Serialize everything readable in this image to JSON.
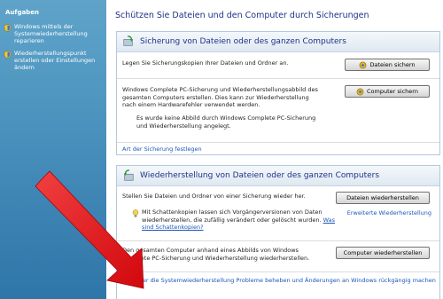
{
  "sidebar": {
    "title": "Aufgaben",
    "tasks": [
      {
        "label": "Windows mittels der Systemwiederherstellung reparieren"
      },
      {
        "label": "Wiederherstellungspunkt erstellen oder Einstellungen ändern"
      }
    ]
  },
  "main": {
    "title": "Schützen Sie Dateien und den Computer durch Sicherungen"
  },
  "backup_panel": {
    "heading": "Sicherung von Dateien oder des ganzen Computers",
    "file_text": "Legen Sie Sicherungskopien Ihrer Dateien und Ordner an.",
    "file_button": "Dateien sichern",
    "pc_text": "Windows Complete PC-Sicherung und Wiederherstellungsabbild des gesamten Computers erstellen. Dies kann zur Wiederherstellung nach einem Hardwarefehler verwendet werden.",
    "pc_button": "Computer sichern",
    "pc_note": "Es wurde keine Abbild durch Windows Complete PC-Sicherung und Wiederherstellung angelegt.",
    "type_link": "Art der Sicherung festlegen"
  },
  "restore_panel": {
    "heading": "Wiederherstellung von Dateien oder des ganzen Computers",
    "file_text": "Stellen Sie Dateien und Ordner von einer Sicherung wieder her.",
    "file_button": "Dateien wiederherstellen",
    "advanced_link": "Erweiterte Wiederherstellung",
    "shadow_text": "Mit Schattenkopien lassen sich Vorgängerversionen von Daten wiederherstellen, die zufällig verändert oder gelöscht wurden.",
    "shadow_link": "Was sind Schattenkopien?",
    "pc_text": "Den gesamten Computer anhand eines Abbilds von Windows Complete PC-Sicherung und Wiederherstellung wiederherstellen.",
    "pc_button": "Computer wiederherstellen",
    "system_link": "Über die Systemwiederherstellung Probleme beheben und Änderungen an Windows rückgängig machen"
  },
  "colors": {
    "sidebar": "#4e96c0",
    "title": "#1e3287",
    "link": "#1a56b8",
    "arrow": "#e8151b"
  }
}
